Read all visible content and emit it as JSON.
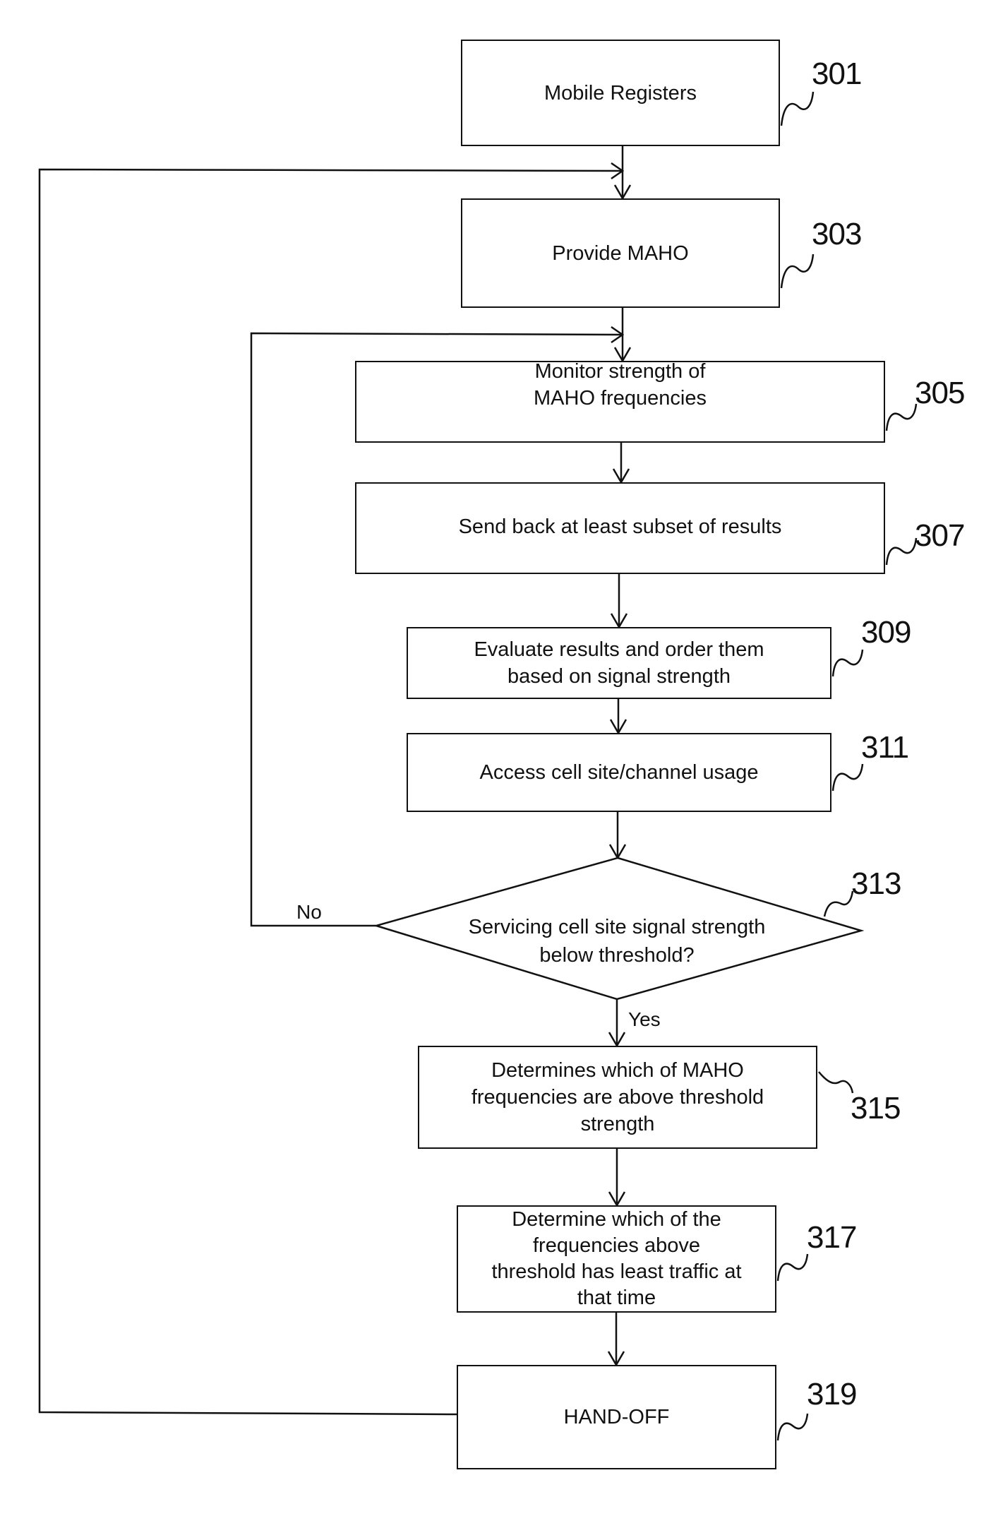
{
  "diagram": {
    "type": "flowchart",
    "steps": [
      {
        "id": "301",
        "text": "Mobile Registers"
      },
      {
        "id": "303",
        "text": "Provide MAHO"
      },
      {
        "id": "305",
        "text": "Monitor strength of MAHO frequencies",
        "lines": [
          "Monitor strength of",
          "MAHO frequencies"
        ]
      },
      {
        "id": "307",
        "text": "Send back at least subset of results"
      },
      {
        "id": "309",
        "text": "Evaluate results and order them based on signal strength",
        "lines": [
          "Evaluate results and order them",
          "based on signal strength"
        ]
      },
      {
        "id": "311",
        "text": "Access cell site/channel usage"
      },
      {
        "id": "313",
        "text": "Servicing cell site signal strength below threshold?",
        "lines": [
          "Servicing cell site signal strength",
          "below threshold?"
        ],
        "shape": "decision"
      },
      {
        "id": "315",
        "text": "Determines which of MAHO frequencies are above threshold strength",
        "lines": [
          "Determines which of MAHO",
          "frequencies are above threshold",
          "strength"
        ]
      },
      {
        "id": "317",
        "text": "Determine which of the frequencies above threshold has least traffic at that time",
        "lines": [
          "Determine which of the",
          "frequencies above",
          "threshold has least traffic at",
          "that time"
        ]
      },
      {
        "id": "319",
        "text": "HAND-OFF"
      }
    ],
    "edges": [
      {
        "from": "301",
        "to": "303"
      },
      {
        "from": "303",
        "to": "305"
      },
      {
        "from": "305",
        "to": "307"
      },
      {
        "from": "307",
        "to": "309"
      },
      {
        "from": "309",
        "to": "311"
      },
      {
        "from": "311",
        "to": "313"
      },
      {
        "from": "313",
        "to": "315",
        "label": "Yes"
      },
      {
        "from": "313",
        "to": "305",
        "label": "No"
      },
      {
        "from": "315",
        "to": "317"
      },
      {
        "from": "317",
        "to": "319"
      },
      {
        "from": "319",
        "to": "303"
      }
    ],
    "labels": {
      "yes": "Yes",
      "no": "No"
    }
  }
}
